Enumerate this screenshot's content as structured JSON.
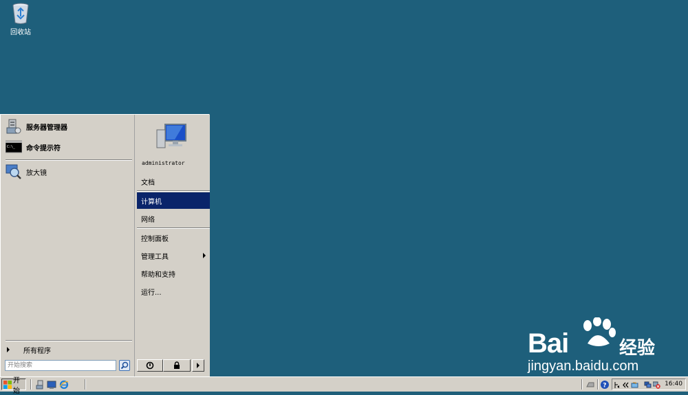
{
  "desktop": {
    "recycle_bin_label": "回收站",
    "background_color": "#1e5f7b"
  },
  "watermark": {
    "brand": "Bai",
    "brand_cn": "经验",
    "site": "jingyan.baidu.com"
  },
  "start_menu": {
    "pinned": [
      {
        "label": "服务器管理器",
        "icon": "server-manager-icon"
      },
      {
        "label": "命令提示符",
        "icon": "command-prompt-icon"
      }
    ],
    "recent": [
      {
        "label": "放大镜",
        "icon": "magnifier-icon"
      }
    ],
    "all_programs_label": "所有程序",
    "search_placeholder": "开始搜索",
    "user_name": "administrator",
    "right_items": [
      {
        "label": "文档"
      },
      {
        "label": "计算机",
        "selected": true
      },
      {
        "label": "网络"
      },
      {
        "label": "控制面板"
      },
      {
        "label": "管理工具",
        "has_submenu": true
      },
      {
        "label": "帮助和支持"
      },
      {
        "label": "运行..."
      }
    ],
    "selection_color": "#0a246a"
  },
  "taskbar": {
    "start_label": "开始",
    "clock": "16:40",
    "quick_launch": [
      "server-manager-icon",
      "show-desktop-icon",
      "internet-explorer-icon"
    ]
  }
}
